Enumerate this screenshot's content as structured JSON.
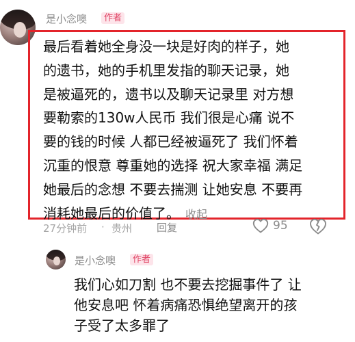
{
  "main_comment": {
    "author": "是小念噢",
    "badge": "作者",
    "lines": [
      "最后看着她全身没一块是好肉的样子，她",
      "的遗书，她的手机里发指的聊天记录，她",
      "是被逼死的，遗书以及聊天记录里 对方想",
      "要勒索的130w人民币  我们很是心痛 说不",
      "要的钱的时候 人都已经被逼死了 我们怀着",
      "沉重的恨意 尊重她的选择 祝大家幸福 满足",
      "她最后的念想 不要去揣测 让她安息 不要再",
      "消耗她最后的价值了。"
    ],
    "collapse_label": "收起",
    "time": "27分钟前",
    "separator": "·",
    "location": "贵州",
    "reply_label": "回复",
    "like_count": "95",
    "highlight_color": "#e3242b"
  },
  "reply_comment": {
    "author": "是小念噢",
    "badge": "作者",
    "lines": [
      "我们心如刀割 也不要去挖掘事件了 让",
      "他安息吧 怀着病痛恐惧绝望离开的孩",
      "子受了太多罪了"
    ]
  },
  "icons": {
    "like": "heart-outline-icon",
    "dislike": "broken-heart-icon"
  }
}
